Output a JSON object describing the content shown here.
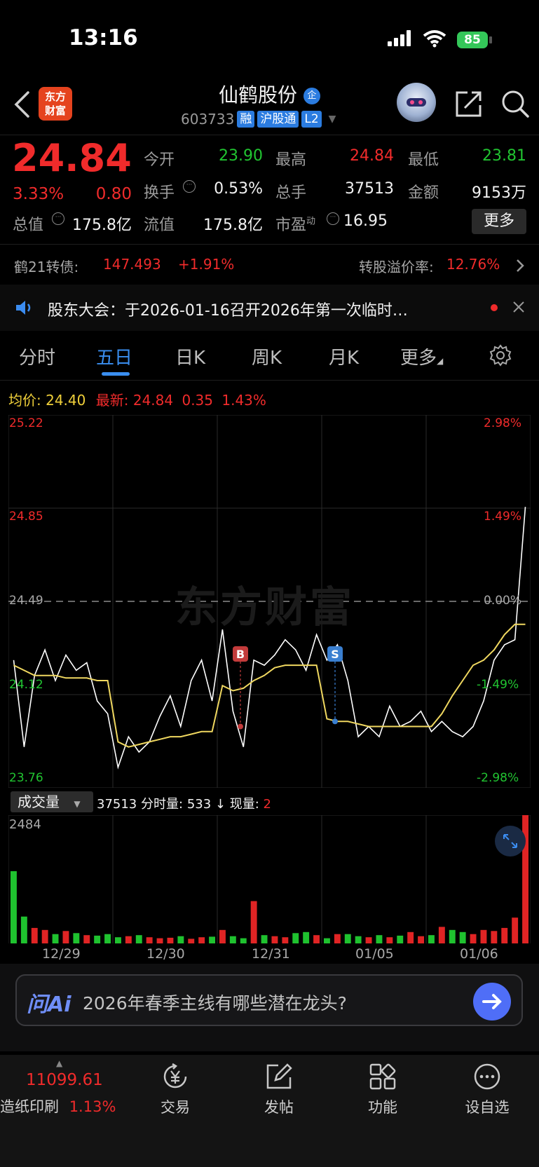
{
  "status_bar": {
    "time": "13:16",
    "battery": "85"
  },
  "header": {
    "logo_text": [
      "东方",
      "财富"
    ],
    "stock_name": "仙鹤股份",
    "name_badge": "企",
    "code": "603733",
    "tags": [
      "融",
      "沪股通",
      "L2"
    ]
  },
  "quote": {
    "price": "24.84",
    "change_pct": "3.33%",
    "change": "0.80",
    "open_label": "今开",
    "open": "23.90",
    "high_label": "最高",
    "high": "24.84",
    "low_label": "最低",
    "low": "23.81",
    "turnover_label": "换手",
    "turnover": "0.53%",
    "volume_label": "总手",
    "volume": "37513",
    "amount_label": "金额",
    "amount": "9153万",
    "mktcap_label": "总值",
    "mktcap": "175.8亿",
    "float_label": "流值",
    "float_cap": "175.8亿",
    "pe_label": "市盈",
    "pe_sup": "动",
    "pe": "16.95",
    "more_label": "更多"
  },
  "bond": {
    "name": "鹤21转债:",
    "price": "147.493",
    "change": "+1.91%",
    "premium_label": "转股溢价率:",
    "premium": "12.76%"
  },
  "notice": {
    "text": "股东大会：于2026-01-16召开2026年第一次临时…"
  },
  "tabs": [
    "分时",
    "五日",
    "日K",
    "周K",
    "月K",
    "更多"
  ],
  "chart_info": {
    "avg_label": "均价:",
    "avg": "24.40",
    "latest_label": "最新:",
    "latest": "24.84",
    "change": "0.35",
    "change_pct": "1.43%",
    "watermark": "东方财富"
  },
  "volume_bar": {
    "button": "成交量",
    "total": "37513",
    "minute_label": "分时量:",
    "minute": "533",
    "current_label": "现量:",
    "current": "2"
  },
  "chart_data": {
    "type": "line",
    "title": "",
    "x_dates": [
      "12/29",
      "12/30",
      "12/31",
      "01/05",
      "01/06"
    ],
    "y_ticks_left": [
      "25.22",
      "24.85",
      "24.49",
      "24.12",
      "23.76"
    ],
    "y_ticks_right": [
      "2.98%",
      "1.49%",
      "0.00%",
      "-1.49%",
      "-2.98%"
    ],
    "ylim": [
      23.76,
      25.22
    ],
    "prev_close": 24.49,
    "series": [
      {
        "name": "价格",
        "color": "#ffffff",
        "values": [
          24.26,
          23.92,
          24.2,
          24.3,
          24.18,
          24.28,
          24.22,
          24.25,
          24.1,
          24.05,
          23.84,
          23.96,
          23.9,
          23.94,
          24.04,
          24.12,
          24.0,
          24.18,
          24.26,
          24.1,
          24.38,
          24.06,
          23.92,
          24.26,
          24.24,
          24.28,
          24.34,
          24.3,
          24.22,
          24.36,
          24.26,
          24.32,
          24.18,
          23.96,
          24.0,
          23.96,
          24.08,
          24.0,
          24.02,
          24.06,
          23.98,
          24.02,
          23.98,
          23.96,
          24.0,
          24.1,
          24.26,
          24.32,
          24.34,
          24.86
        ]
      },
      {
        "name": "均价",
        "color": "#f0d860",
        "values": [
          24.24,
          24.22,
          24.2,
          24.2,
          24.2,
          24.19,
          24.19,
          24.19,
          24.18,
          24.18,
          23.94,
          23.92,
          23.93,
          23.94,
          23.95,
          23.96,
          23.96,
          23.97,
          23.98,
          23.98,
          24.16,
          24.14,
          24.15,
          24.18,
          24.2,
          24.23,
          24.24,
          24.24,
          24.24,
          24.24,
          24.03,
          24.02,
          24.02,
          24.01,
          24.0,
          24.0,
          24.0,
          24.0,
          24.0,
          24.0,
          24.0,
          24.05,
          24.12,
          24.18,
          24.24,
          24.26,
          24.3,
          24.36,
          24.4,
          24.4
        ]
      }
    ],
    "markers": [
      {
        "label": "B",
        "color": "#c33b3b",
        "value": 24.0
      },
      {
        "label": "S",
        "color": "#3a7fd0",
        "value": 24.02
      }
    ],
    "volume": {
      "ymax": 2484,
      "ymax_label": "2484",
      "values": [
        1400,
        520,
        300,
        260,
        180,
        240,
        200,
        160,
        150,
        180,
        120,
        140,
        160,
        120,
        100,
        110,
        140,
        90,
        120,
        130,
        260,
        140,
        100,
        820,
        160,
        140,
        120,
        200,
        220,
        160,
        100,
        180,
        180,
        140,
        120,
        160,
        120,
        150,
        220,
        140,
        160,
        320,
        260,
        220,
        180,
        260,
        240,
        300,
        500,
        2484
      ]
    }
  },
  "ask": {
    "brand": "问Ai",
    "question": "2026年春季主线有哪些潜在龙头?"
  },
  "bottom_nav": {
    "index_name": "造纸印刷",
    "index_value": "11099.61",
    "index_change": "1.13%",
    "items": [
      "交易",
      "发帖",
      "功能",
      "设自选"
    ]
  }
}
